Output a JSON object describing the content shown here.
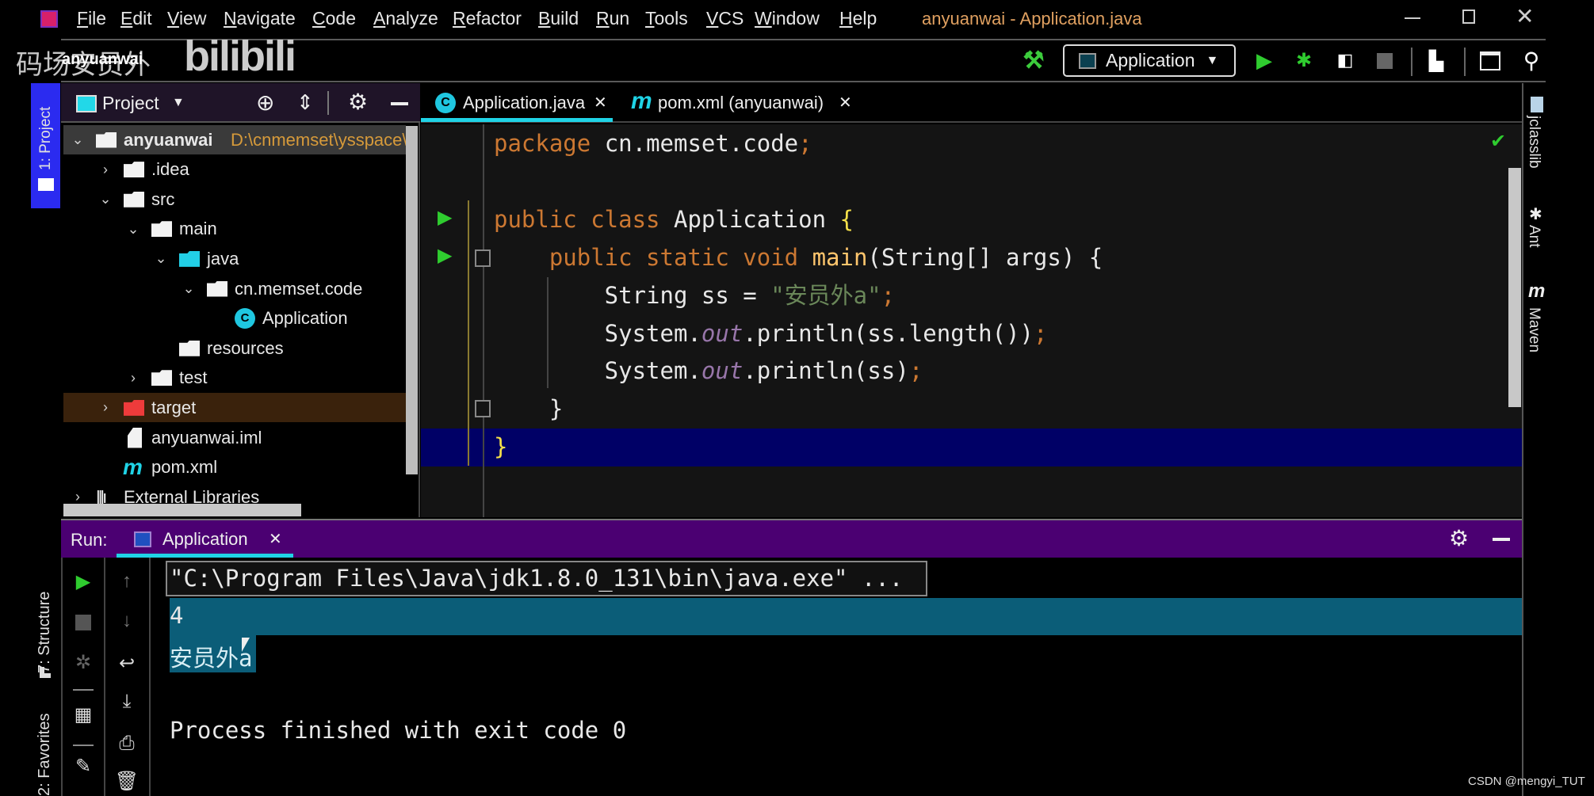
{
  "menu": [
    "File",
    "Edit",
    "View",
    "Navigate",
    "Code",
    "Analyze",
    "Refactor",
    "Build",
    "Run",
    "Tools",
    "VCS",
    "Window",
    "Help"
  ],
  "window_title": "anyuanwai - Application.java",
  "watermark": {
    "channel": "码场安员外",
    "logo": "bilibili"
  },
  "breadcrumb": "anyuanwai",
  "toolbar": {
    "run_config": "Application"
  },
  "left_stripe": {
    "project": "1: Project",
    "structure": "7: Structure",
    "favorites": "2: Favorites"
  },
  "right_stripe": [
    "jclasslib",
    "Ant",
    "Maven"
  ],
  "project_panel": {
    "title": "Project",
    "tree": [
      {
        "label": "anyuanwai",
        "path": "D:\\cnmemset\\ysspace\\",
        "level": 0,
        "expanded": true,
        "icon": "module-folder"
      },
      {
        "label": ".idea",
        "level": 1,
        "expanded": false,
        "icon": "folder"
      },
      {
        "label": "src",
        "level": 1,
        "expanded": true,
        "icon": "folder"
      },
      {
        "label": "main",
        "level": 2,
        "expanded": true,
        "icon": "folder"
      },
      {
        "label": "java",
        "level": 3,
        "expanded": true,
        "icon": "source-folder"
      },
      {
        "label": "cn.memset.code",
        "level": 4,
        "expanded": true,
        "icon": "package"
      },
      {
        "label": "Application",
        "level": 5,
        "icon": "class"
      },
      {
        "label": "resources",
        "level": 3,
        "icon": "resources-folder"
      },
      {
        "label": "test",
        "level": 2,
        "expanded": false,
        "icon": "folder"
      },
      {
        "label": "target",
        "level": 1,
        "expanded": false,
        "icon": "excluded-folder"
      },
      {
        "label": "anyuanwai.iml",
        "level": 1,
        "icon": "iml-file"
      },
      {
        "label": "pom.xml",
        "level": 1,
        "icon": "maven"
      },
      {
        "label": "External Libraries",
        "level": 0,
        "expanded": false,
        "icon": "libraries"
      }
    ]
  },
  "editor": {
    "tabs": [
      {
        "label": "Application.java",
        "active": true
      },
      {
        "label": "pom.xml (anyuanwai)",
        "active": false
      }
    ],
    "lines": [
      [
        {
          "t": "package ",
          "c": "kw"
        },
        {
          "t": "cn.memset.code",
          "c": "id"
        },
        {
          "t": ";",
          "c": "kw"
        }
      ],
      [],
      [
        {
          "t": "public class ",
          "c": "kw"
        },
        {
          "t": "Application ",
          "c": "id"
        },
        {
          "t": "{",
          "c": "br"
        }
      ],
      [
        {
          "t": "    public static void ",
          "c": "kw"
        },
        {
          "t": "main",
          "c": "fn"
        },
        {
          "t": "(String[] args) {",
          "c": "id"
        }
      ],
      [
        {
          "t": "        String ss = ",
          "c": "id"
        },
        {
          "t": "\"安员外a\"",
          "c": "str"
        },
        {
          "t": ";",
          "c": "kw"
        }
      ],
      [
        {
          "t": "        System.",
          "c": "id"
        },
        {
          "t": "out",
          "c": "fld"
        },
        {
          "t": ".println(ss.length())",
          "c": "id"
        },
        {
          "t": ";",
          "c": "kw"
        }
      ],
      [
        {
          "t": "        System.",
          "c": "id"
        },
        {
          "t": "out",
          "c": "fld"
        },
        {
          "t": ".println(ss)",
          "c": "id"
        },
        {
          "t": ";",
          "c": "kw"
        }
      ],
      [
        {
          "t": "    }",
          "c": "id"
        }
      ],
      [
        {
          "t": "}",
          "c": "br"
        }
      ]
    ]
  },
  "run_panel": {
    "label": "Run:",
    "tab": "Application",
    "output": [
      "\"C:\\Program Files\\Java\\jdk1.8.0_131\\bin\\java.exe\" ...",
      "4",
      "安员外a",
      "",
      "Process finished with exit code 0"
    ]
  },
  "footer_watermark": "CSDN @mengyi_TUT",
  "colors": {
    "keyword": "#cc7832",
    "string": "#6a8759",
    "field": "#9876aa",
    "method": "#ffc66d",
    "run_header": "#4b0072",
    "selection": "#0b5d78",
    "current_line": "#000066",
    "accent": "#1fd3e6"
  }
}
